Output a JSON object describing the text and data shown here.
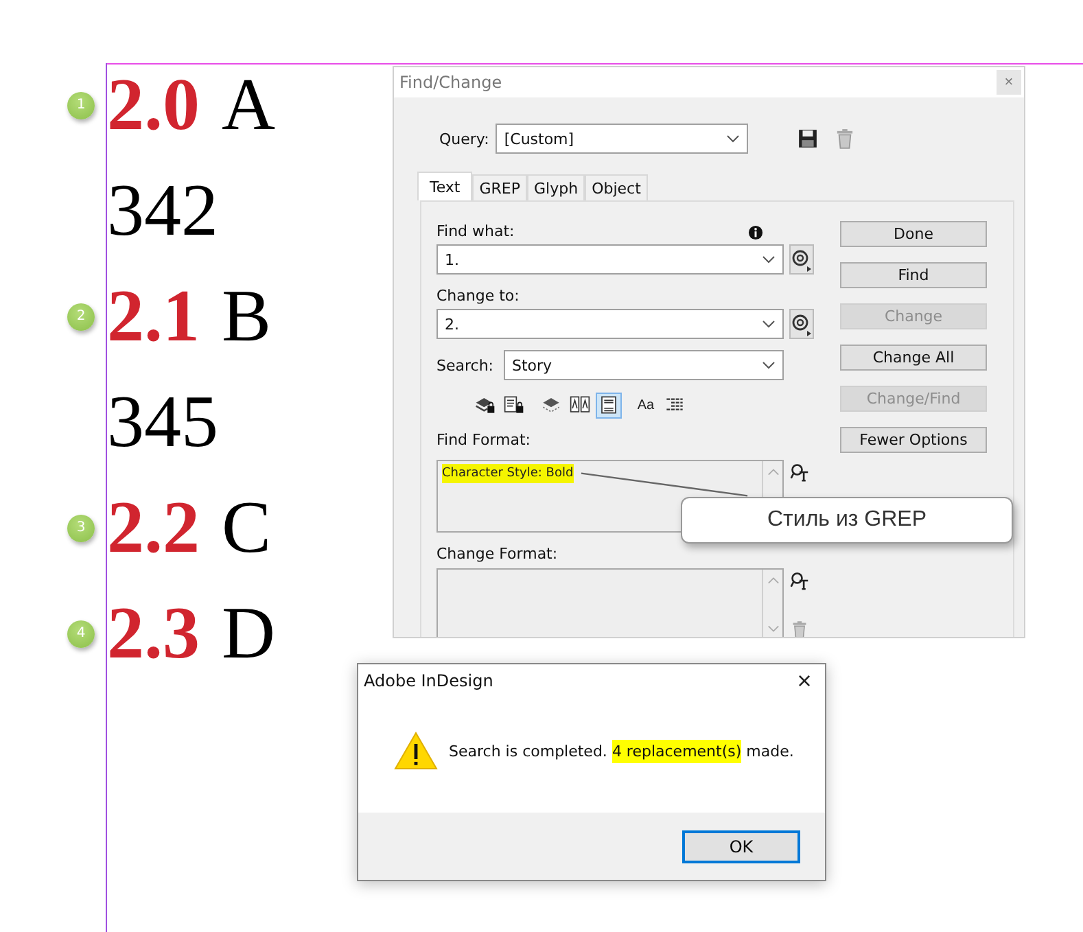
{
  "document": {
    "lines": [
      {
        "kind": "heading",
        "marker": "1",
        "number": "2.0",
        "text": "A"
      },
      {
        "kind": "plain",
        "text": "342"
      },
      {
        "kind": "heading",
        "marker": "2",
        "number": "2.1",
        "text": "B"
      },
      {
        "kind": "plain",
        "text": "345"
      },
      {
        "kind": "heading",
        "marker": "3",
        "number": "2.2",
        "text": "C"
      },
      {
        "kind": "heading",
        "marker": "4",
        "number": "2.3",
        "text": "D"
      }
    ]
  },
  "find_change": {
    "title": "Find/Change",
    "close": "×",
    "query": {
      "label": "Query:",
      "value": "[Custom]"
    },
    "tabs": [
      {
        "label": "Text",
        "selected": true
      },
      {
        "label": "GREP",
        "selected": false
      },
      {
        "label": "Glyph",
        "selected": false
      },
      {
        "label": "Object",
        "selected": false
      }
    ],
    "find_what": {
      "label": "Find what:",
      "value": "1."
    },
    "change_to": {
      "label": "Change to:",
      "value": "2."
    },
    "search": {
      "label": "Search:",
      "value": "Story"
    },
    "search_options": [
      {
        "kind": "locked-layers",
        "selected": false
      },
      {
        "kind": "locked-stories",
        "selected": false
      },
      {
        "kind": "hidden-layers",
        "selected": false
      },
      {
        "kind": "master-pages",
        "selected": false
      },
      {
        "kind": "footnotes",
        "selected": true
      },
      {
        "kind": "case",
        "label": "Aa",
        "selected": false
      },
      {
        "kind": "whole-word",
        "selected": false
      }
    ],
    "find_format": {
      "label": "Find Format:",
      "value": "Character Style: Bold",
      "highlighted": true
    },
    "change_format": {
      "label": "Change Format:"
    },
    "buttons": [
      {
        "label": "Done",
        "disabled": false
      },
      {
        "label": "Find",
        "disabled": false
      },
      {
        "label": "Change",
        "disabled": true
      },
      {
        "label": "Change All",
        "disabled": false
      },
      {
        "label": "Change/Find",
        "disabled": true
      },
      {
        "label": "Fewer Options",
        "disabled": false
      }
    ]
  },
  "callout": {
    "text": "Стиль из GREP"
  },
  "alert": {
    "title": "Adobe InDesign",
    "close": "×",
    "message": [
      {
        "text": "Search is completed. ",
        "highlighted": false
      },
      {
        "text": "4 replacement(s)",
        "highlighted": true
      },
      {
        "text": " made.",
        "highlighted": false
      }
    ],
    "button": "OK"
  }
}
